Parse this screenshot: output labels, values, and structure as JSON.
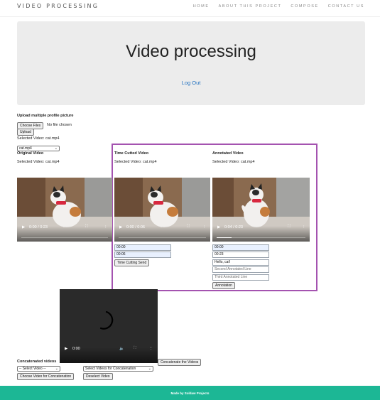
{
  "nav": {
    "brand": "VIDEO PROCESSING",
    "links": [
      "HOME",
      "ABOUT THIS PROJECT",
      "COMPOSE",
      "CONTACT US"
    ]
  },
  "hero": {
    "title": "Video processing",
    "logout": "Log Out"
  },
  "upload": {
    "heading": "Upload multiple profile picture",
    "choose_label": "Choose Files",
    "no_file": "No file chosen",
    "upload_label": "Upload",
    "selected": "Selected Video: cat.mp4",
    "select_value": "cat.mp4"
  },
  "original": {
    "heading": "Original Video",
    "selected": "Selected Video: cat.mp4",
    "time": "0:00 / 0:23",
    "progress": 0
  },
  "cut": {
    "heading": "Time Cutted Video",
    "selected": "Selected Video: cat.mp4",
    "time": "0:00 / 0:06",
    "progress": 0,
    "start_value": "00:00",
    "end_value": "00:06",
    "send_label": "Time Cutting Send"
  },
  "annotated": {
    "heading": "Annotated Video",
    "selected": "Selected Video: cat.mp4",
    "time": "0:04 / 0:23",
    "progress": 0.17,
    "start_value": "00:00",
    "end_value": "00:23",
    "line1_value": "Hello, cat!",
    "line2_placeholder": "Second Annotated Line",
    "line3_placeholder": "Third Annotated Line",
    "annotate_label": "Annotation"
  },
  "concat": {
    "player_time": "0:00",
    "heading": "Concatenated videos",
    "concat_button": "Concatenate the Videos",
    "select_video": "-- Select Video --",
    "select_for_concat": "Select Videos for Concatenation",
    "choose_button": "Choose Video for Concatenation",
    "deselect_button": "Deselect Video"
  },
  "footer": {
    "text": "Made by Soldaw Projects"
  }
}
